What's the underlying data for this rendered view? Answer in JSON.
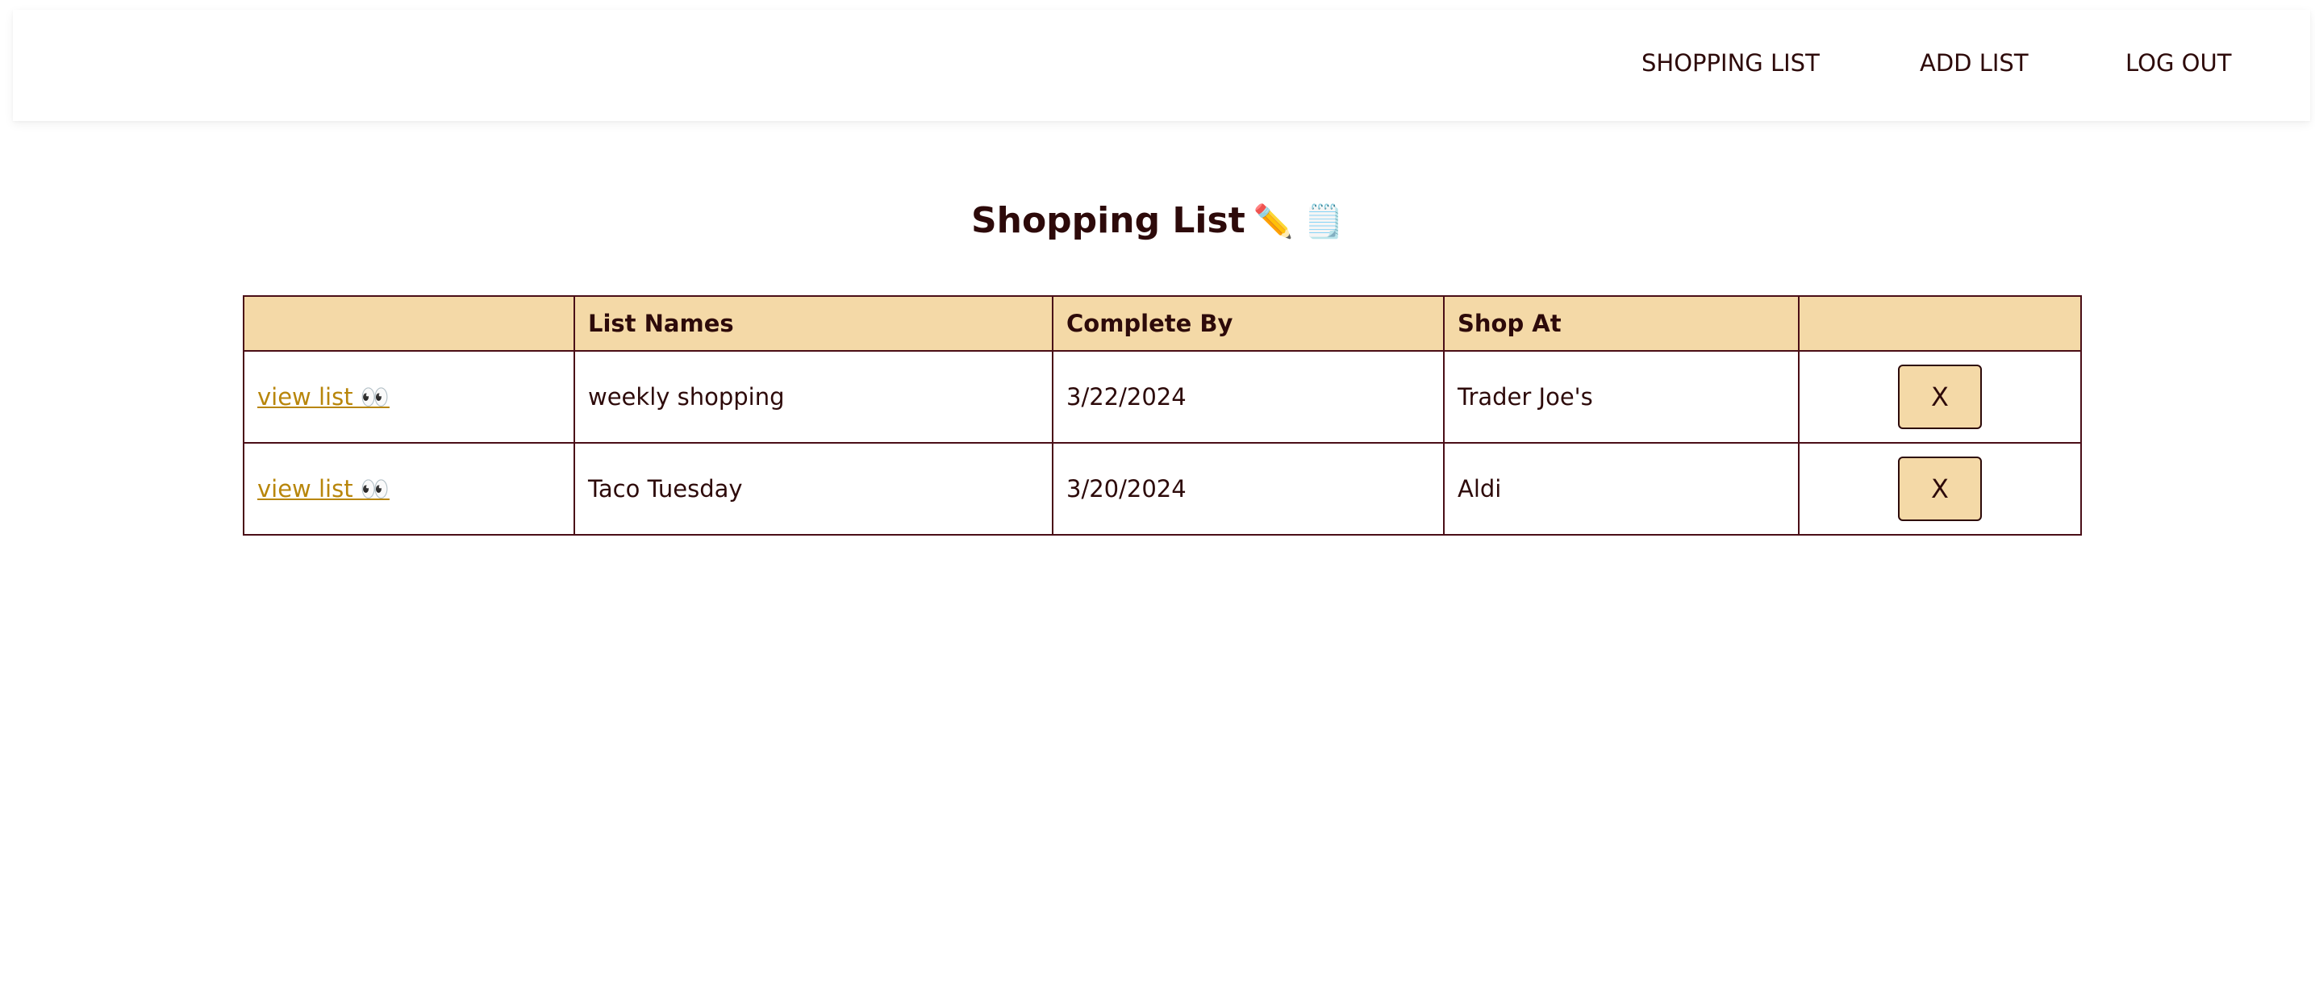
{
  "nav": {
    "items": [
      {
        "label": "SHOPPING LIST"
      },
      {
        "label": "ADD LIST"
      },
      {
        "label": "LOG OUT"
      }
    ]
  },
  "page": {
    "title": "Shopping List",
    "title_emojis": "✏️ 🗒️"
  },
  "table": {
    "headers": [
      "",
      "List Names",
      "Complete By",
      "Shop At",
      ""
    ],
    "rows": [
      {
        "view_label": "view list 👀",
        "name": "weekly shopping",
        "complete_by": "3/22/2024",
        "shop_at": "Trader Joe's",
        "delete_label": "X"
      },
      {
        "view_label": "view list 👀",
        "name": "Taco Tuesday",
        "complete_by": "3/20/2024",
        "shop_at": "Aldi",
        "delete_label": "X"
      }
    ]
  },
  "colors": {
    "accent": "#f4d9a7",
    "text": "#2d0a0a",
    "border": "#4a0e17",
    "link": "#b8860b"
  }
}
